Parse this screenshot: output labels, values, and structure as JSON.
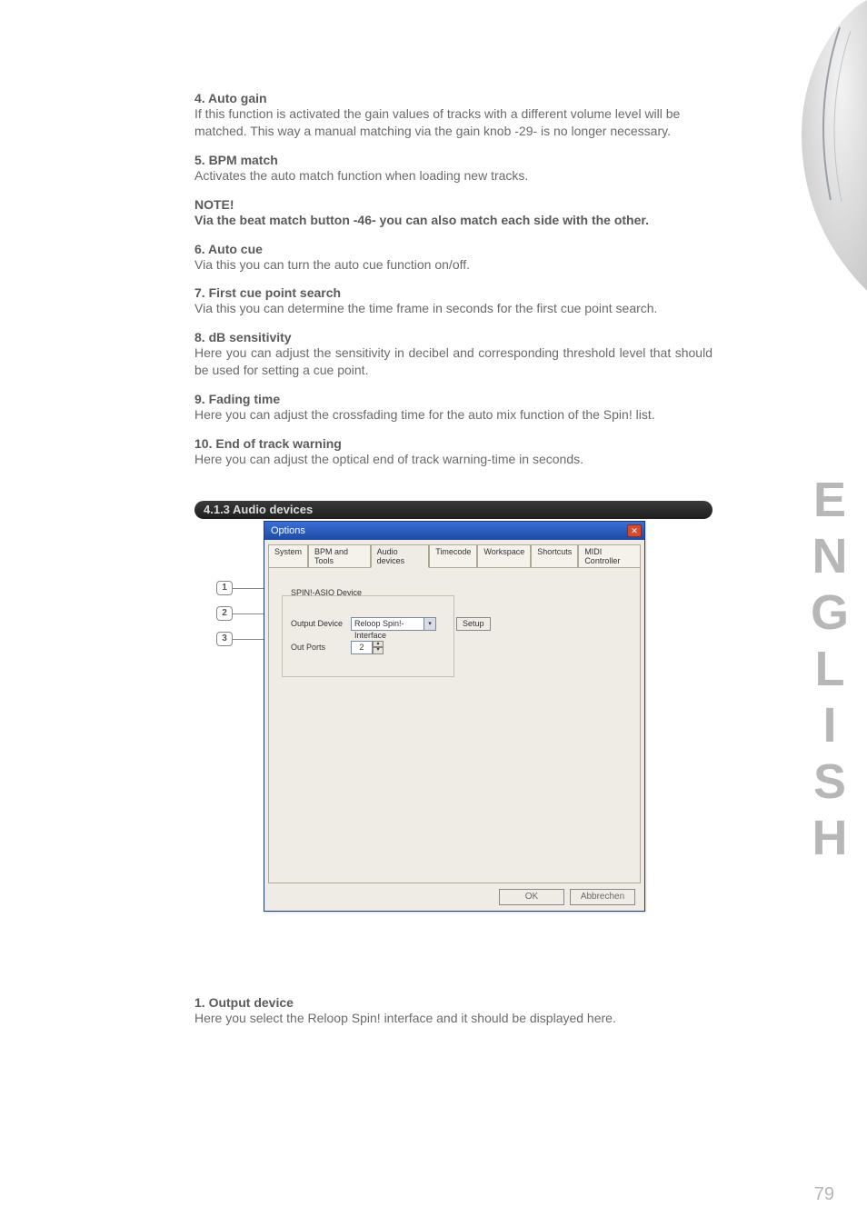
{
  "sections": {
    "s4": {
      "title": "4. Auto gain",
      "body": "If this function is activated the gain values of tracks with a different volume level will be matched. This way a manual matching via the gain knob -29- is no longer necessary."
    },
    "s5": {
      "title": "5. BPM match",
      "body": "Activates the auto match function when loading new tracks."
    },
    "note": {
      "title": "NOTE!",
      "body": "Via the beat match button -46- you can also match each side with the other."
    },
    "s6": {
      "title": "6. Auto cue",
      "body": "Via this you can turn the auto cue function on/off."
    },
    "s7": {
      "title": "7. First cue point search",
      "body": "Via this you can determine the time frame in seconds for the first cue point search."
    },
    "s8": {
      "title": "8. dB sensitivity",
      "body": "Here you can adjust the sensitivity in decibel and corresponding threshold level that should be used for setting a cue point."
    },
    "s9": {
      "title": "9. Fading time",
      "body": "Here you can adjust the crossfading time for the auto mix function of the Spin! list."
    },
    "s10": {
      "title": "10. End of track warning",
      "body": "Here you can adjust the optical end of track warning-time in seconds."
    },
    "s1_out": {
      "title": "1. Output device",
      "body": "Here you select the Reloop Spin! interface and it should be displayed here."
    }
  },
  "header_413": "4.1.3 Audio devices",
  "callouts": {
    "c1": "1",
    "c2": "2",
    "c3": "3"
  },
  "dialog": {
    "title": "Options",
    "tabs": [
      "System",
      "BPM and Tools",
      "Audio devices",
      "Timecode",
      "Workspace",
      "Shortcuts",
      "MIDI Controller"
    ],
    "group_title": "SPIN!-ASIO Device",
    "output_device_label": "Output Device",
    "output_device_value": "Reloop Spin!-Interface",
    "setup_label": "Setup",
    "out_ports_label": "Out Ports",
    "out_ports_value": "2",
    "ok": "OK",
    "cancel": "Abbrechen"
  },
  "side_text": "ENGLISH",
  "page_number": "79"
}
